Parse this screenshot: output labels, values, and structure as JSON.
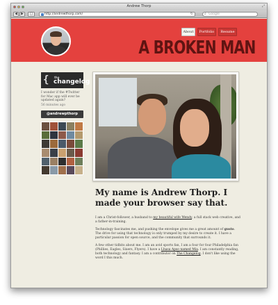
{
  "browser": {
    "window_title": "Andrew Thorp",
    "url": "http://andrewthorp.com/",
    "search_placeholder": "Google"
  },
  "header": {
    "brand": "A BROKEN MAN",
    "nav": [
      "About",
      "Portfolio",
      "Resume"
    ],
    "accent": "#e4413e"
  },
  "sidebar": {
    "changelog_brace": "{",
    "changelog_the": "the",
    "changelog_name": "changelog",
    "tweet_text": "I wonder if the #Twitter for Mac app will ever be updated again?",
    "tweet_time": "56 minutes ago",
    "twitter_handle": "@andrewpthorp"
  },
  "main": {
    "headline": "My name is Andrew Thorp. I made your browser say that.",
    "para1": {
      "before": "I am a Christ-follower, a husband to ",
      "link": "my beautiful wife Wendy",
      "after": ", a full stack web creative, and a father-in-training."
    },
    "para2": {
      "before": "Technology fascinates me, and pushing the envelope gives me a great amount of ",
      "bold": "gusto",
      "after": ". The drive for using that technology is only trumped by my desire to create it. I have a particular passion for open source, and the community that surrounds it."
    },
    "para3": {
      "before": "A few other tidbits about me. I am an avid sports fan, I am a four for four Philadelphia fan (Phillies, Eagles, Sixers, Flyers). I have a ",
      "link1": "Lhasa Apso named Mia",
      "middle": ". I am constantly reading, both technology and fantasy. I am a contributor on ",
      "link2": "The Changelog",
      "after": ". I don't like using the word I this much."
    }
  }
}
